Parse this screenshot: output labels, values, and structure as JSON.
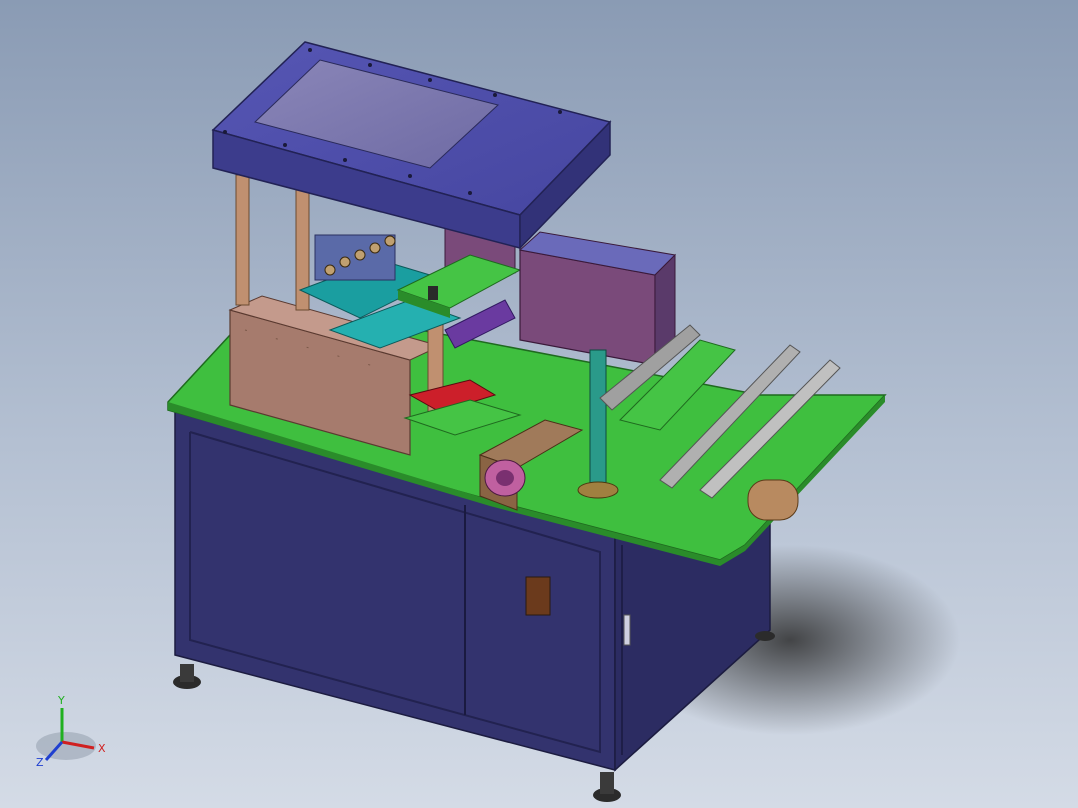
{
  "view": {
    "background_top": "#8a9bb4",
    "background_bottom": "#d4dbe6"
  },
  "model": {
    "frame_color": "#33336e",
    "table_color": "#3fbf3f",
    "hood_color": "#4a4aa0",
    "box_color": "#7a4a7a",
    "guard_color": "#b08070",
    "shadow_color": "#3a3a3a"
  },
  "triad": {
    "x_label": "X",
    "y_label": "Y",
    "z_label": "Z",
    "x_color": "#d02020",
    "y_color": "#20b020",
    "z_color": "#2040d0"
  }
}
